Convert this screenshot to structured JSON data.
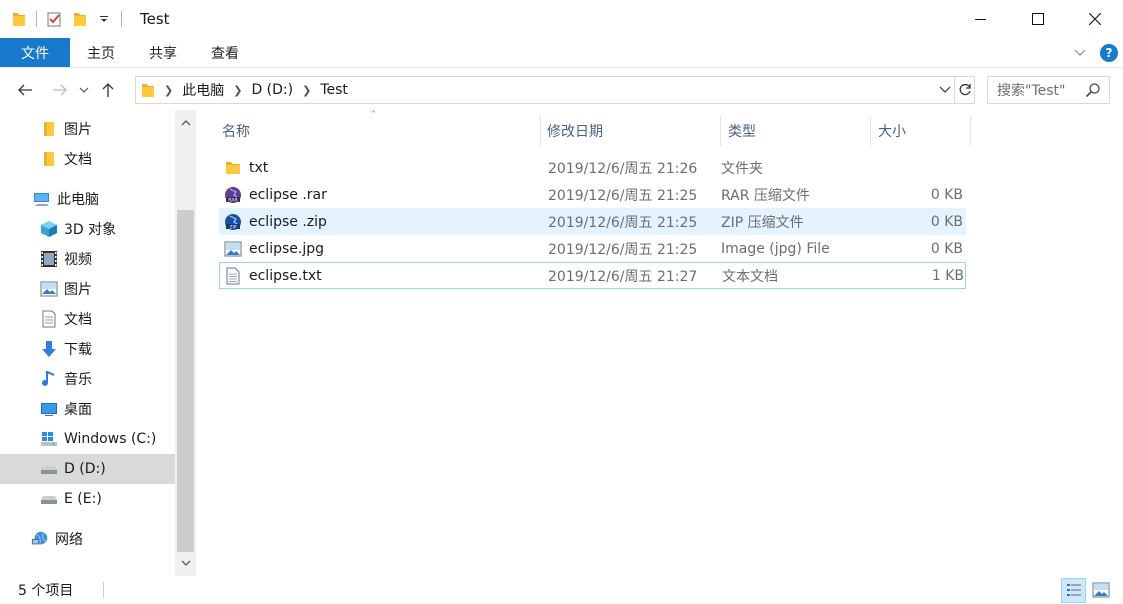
{
  "window": {
    "title": "Test"
  },
  "ribbon": {
    "tabs": [
      {
        "label": "文件"
      },
      {
        "label": "主页"
      },
      {
        "label": "共享"
      },
      {
        "label": "查看"
      }
    ]
  },
  "address": {
    "breadcrumbs": [
      "此电脑",
      "D (D:)",
      "Test"
    ]
  },
  "search": {
    "placeholder": "搜索\"Test\""
  },
  "sidebar": {
    "items": [
      {
        "label": "图片",
        "icon": "folder-icon"
      },
      {
        "label": "文档",
        "icon": "folder-icon"
      },
      {
        "label": "此电脑",
        "icon": "computer-icon"
      },
      {
        "label": "3D 对象",
        "icon": "3d-objects-icon"
      },
      {
        "label": "视频",
        "icon": "video-icon"
      },
      {
        "label": "图片",
        "icon": "pictures-icon"
      },
      {
        "label": "文档",
        "icon": "documents-icon"
      },
      {
        "label": "下载",
        "icon": "download-icon"
      },
      {
        "label": "音乐",
        "icon": "music-icon"
      },
      {
        "label": "桌面",
        "icon": "desktop-icon"
      },
      {
        "label": "Windows (C:)",
        "icon": "windows-drive-icon"
      },
      {
        "label": "D (D:)",
        "icon": "drive-icon",
        "selected": true
      },
      {
        "label": "E (E:)",
        "icon": "drive-icon"
      },
      {
        "label": "网络",
        "icon": "network-icon"
      }
    ]
  },
  "columns": {
    "name": "名称",
    "date": "修改日期",
    "type": "类型",
    "size": "大小"
  },
  "files": [
    {
      "name": "txt",
      "date": "2019/12/6/周五 21:26",
      "type": "文件夹",
      "size": "",
      "icon": "folder-icon"
    },
    {
      "name": "eclipse .rar",
      "date": "2019/12/6/周五 21:25",
      "type": "RAR 压缩文件",
      "size": "0 KB",
      "icon": "rar-icon"
    },
    {
      "name": "eclipse .zip",
      "date": "2019/12/6/周五 21:25",
      "type": "ZIP 压缩文件",
      "size": "0 KB",
      "icon": "zip-icon"
    },
    {
      "name": "eclipse.jpg",
      "date": "2019/12/6/周五 21:25",
      "type": "Image (jpg) File",
      "size": "0 KB",
      "icon": "image-file-icon"
    },
    {
      "name": "eclipse.txt",
      "date": "2019/12/6/周五 21:27",
      "type": "文本文档",
      "size": "1 KB",
      "icon": "text-file-icon"
    }
  ],
  "status": {
    "item_count": "5 个项目"
  },
  "colors": {
    "accent": "#1979ca",
    "hover_row": "#e5f3ff",
    "folder": "#ffc83d"
  }
}
